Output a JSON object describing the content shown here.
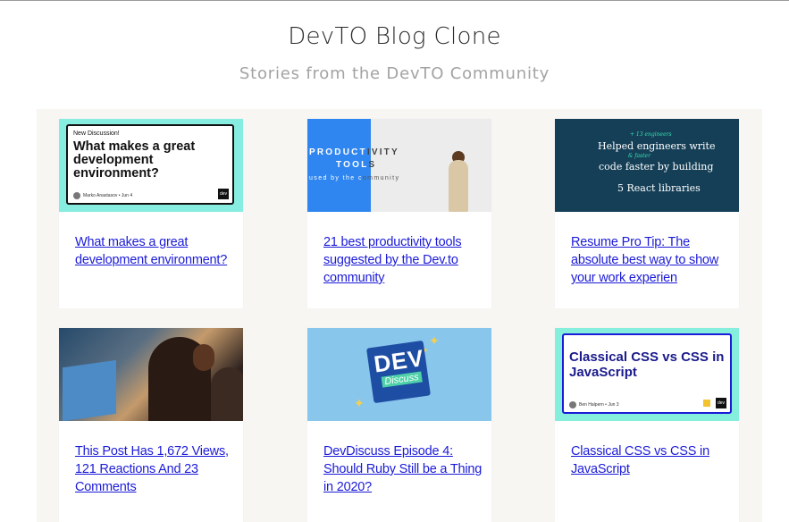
{
  "header": {
    "title": "DevTO Blog Clone",
    "subtitle": "Stories from the DevTO Community"
  },
  "posts": [
    {
      "title": "What makes a great development environment?",
      "cover": {
        "tag": "New Discussion!",
        "headline": "What makes a great development environment?",
        "author": "Marko Anastasov • Jun 4",
        "logo": "dev"
      }
    },
    {
      "title": "21 best productivity tools suggested by the Dev.to community",
      "cover": {
        "line1_a": "PRODUCT",
        "line1_b": "IVITY",
        "line2_a": "TOOL",
        "line2_b": "S",
        "line3_a": "used by the c",
        "line3_b": "ommunity"
      }
    },
    {
      "title": "Resume Pro Tip: The absolute best way to show your work experien",
      "cover": {
        "line1": "Helped engineers write",
        "line2": "code faster by building",
        "line3": "5 React libraries",
        "note1": "+ 13 engineers",
        "note2": "& faster"
      }
    },
    {
      "title": "This Post Has 1,672 Views, 121 Reactions And 23 Comments",
      "cover": {}
    },
    {
      "title": "DevDiscuss Episode 4: Should Ruby Still be a Thing in 2020?",
      "cover": {
        "badge_top": "DEV",
        "badge_bottom": "Discuss"
      }
    },
    {
      "title": "Classical CSS vs CSS in JavaScript",
      "cover": {
        "headline": "Classical CSS vs CSS in JavaScript",
        "author": "Ben Halpern • Jun 3",
        "logo": "dev"
      }
    }
  ]
}
